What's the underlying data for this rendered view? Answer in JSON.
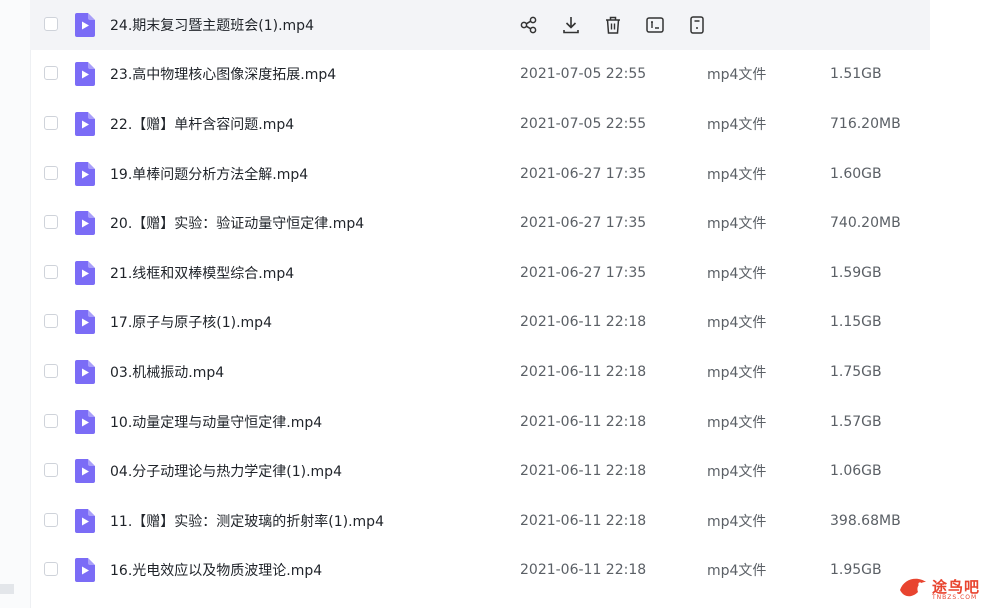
{
  "accent_color": "#7b6cf6",
  "hover_actions": [
    {
      "name": "share-icon"
    },
    {
      "name": "download-icon"
    },
    {
      "name": "delete-icon"
    },
    {
      "name": "rename-icon"
    },
    {
      "name": "more-icon"
    }
  ],
  "files": [
    {
      "name": "24.期末复习暨主题班会(1).mp4",
      "date": "",
      "type": "",
      "size": "",
      "hovered": true
    },
    {
      "name": "23.高中物理核心图像深度拓展.mp4",
      "date": "2021-07-05 22:55",
      "type": "mp4文件",
      "size": "1.51GB"
    },
    {
      "name": "22.【赠】单杆含容问题.mp4",
      "date": "2021-07-05 22:55",
      "type": "mp4文件",
      "size": "716.20MB"
    },
    {
      "name": "19.单棒问题分析方法全解.mp4",
      "date": "2021-06-27 17:35",
      "type": "mp4文件",
      "size": "1.60GB"
    },
    {
      "name": "20.【赠】实验：验证动量守恒定律.mp4",
      "date": "2021-06-27 17:35",
      "type": "mp4文件",
      "size": "740.20MB"
    },
    {
      "name": "21.线框和双棒模型综合.mp4",
      "date": "2021-06-27 17:35",
      "type": "mp4文件",
      "size": "1.59GB"
    },
    {
      "name": "17.原子与原子核(1).mp4",
      "date": "2021-06-11 22:18",
      "type": "mp4文件",
      "size": "1.15GB"
    },
    {
      "name": "03.机械振动.mp4",
      "date": "2021-06-11 22:18",
      "type": "mp4文件",
      "size": "1.75GB"
    },
    {
      "name": "10.动量定理与动量守恒定律.mp4",
      "date": "2021-06-11 22:18",
      "type": "mp4文件",
      "size": "1.57GB"
    },
    {
      "name": "04.分子动理论与热力学定律(1).mp4",
      "date": "2021-06-11 22:18",
      "type": "mp4文件",
      "size": "1.06GB"
    },
    {
      "name": "11.【赠】实验：测定玻璃的折射率(1).mp4",
      "date": "2021-06-11 22:18",
      "type": "mp4文件",
      "size": "398.68MB"
    },
    {
      "name": "16.光电效应以及物质波理论.mp4",
      "date": "2021-06-11 22:18",
      "type": "mp4文件",
      "size": "1.95GB"
    }
  ],
  "watermark": {
    "text": "途鸟吧",
    "sub": "TNBZS.COM"
  }
}
